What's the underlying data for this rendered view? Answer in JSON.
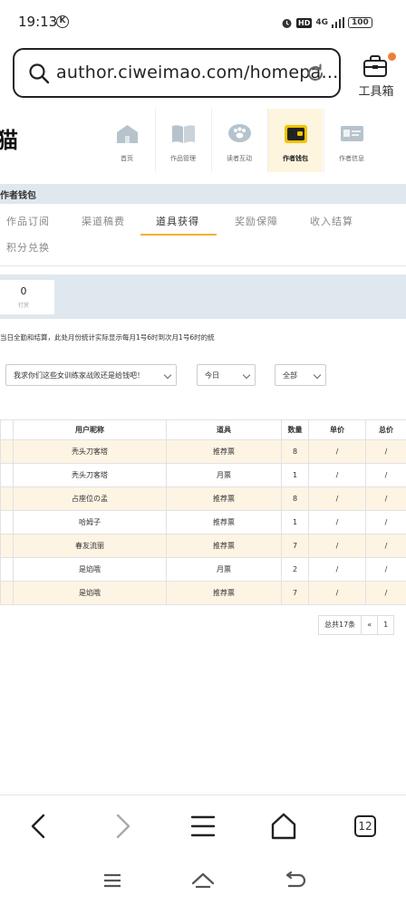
{
  "status": {
    "time": "19:13",
    "k": "K",
    "hd": "HD",
    "net": "4G",
    "battery": "100"
  },
  "browser": {
    "url": "author.ciweimao.com/homepa…",
    "toolbox_label": "工具箱",
    "tab_count": "12"
  },
  "logo_char": "猫",
  "nav": [
    {
      "label": "首页",
      "icon": "home-icon"
    },
    {
      "label": "作品管理",
      "icon": "book-icon"
    },
    {
      "label": "读者互动",
      "icon": "paw-chat-icon"
    },
    {
      "label": "作者钱包",
      "icon": "wallet-icon",
      "active": true
    },
    {
      "label": "作者信息",
      "icon": "id-card-icon"
    }
  ],
  "section_title": "作者钱包",
  "tabs": [
    "作品订阅",
    "渠道稿费",
    "道具获得",
    "奖励保障",
    "收入结算",
    "积分兑换"
  ],
  "active_tab": "道具获得",
  "summary": {
    "value": "0",
    "label": "打赏"
  },
  "notice": "当日全勤和结算，此处月份统计实际显示每月1号6时到次月1号6时的统",
  "filters": {
    "book": "我求你们这些女训练家战败还是给钱吧！",
    "period": "今日",
    "type": "全部"
  },
  "table": {
    "headers": [
      "",
      "用户昵称",
      "道具",
      "数量",
      "单价",
      "总价"
    ],
    "rows": [
      [
        "",
        "秃头刀客塔",
        "推荐票",
        "8",
        "/",
        "/"
      ],
      [
        "",
        "秃头刀客塔",
        "月票",
        "1",
        "/",
        "/"
      ],
      [
        "",
        "占座位の孟",
        "推荐票",
        "8",
        "/",
        "/"
      ],
      [
        "",
        "哈姆子",
        "推荐票",
        "1",
        "/",
        "/"
      ],
      [
        "",
        "春友流丽",
        "推荐票",
        "7",
        "/",
        "/"
      ],
      [
        "",
        "是焰哦",
        "月票",
        "2",
        "/",
        "/"
      ],
      [
        "",
        "是焰哦",
        "推荐票",
        "7",
        "/",
        "/"
      ]
    ]
  },
  "pager": {
    "total": "总共17条",
    "prev": "«",
    "page": "1"
  },
  "colors": {
    "accent": "#f2b233",
    "band": "#dfe8ee",
    "row_alt": "#fdf4e4",
    "dot": "#f07d3a"
  }
}
